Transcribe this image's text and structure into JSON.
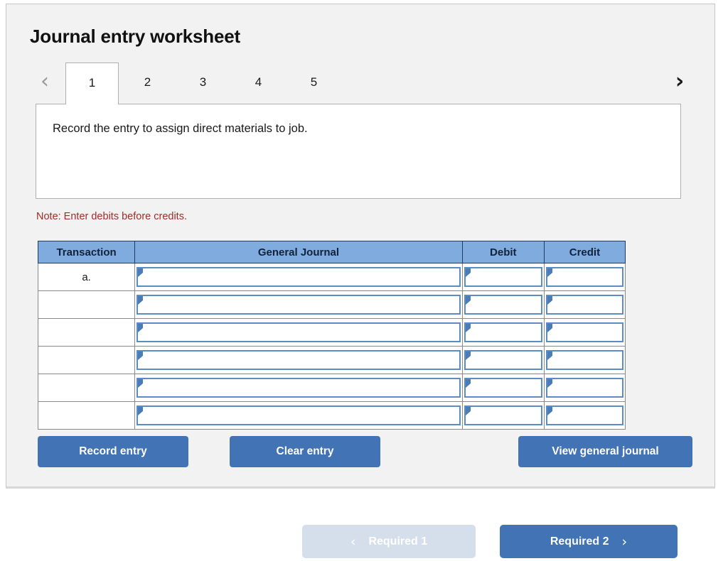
{
  "worksheet": {
    "title": "Journal entry worksheet",
    "tabs": {
      "prev_arrow": "‹",
      "next_arrow": "›",
      "items": [
        {
          "label": "1",
          "active": true
        },
        {
          "label": "2",
          "active": false
        },
        {
          "label": "3",
          "active": false
        },
        {
          "label": "4",
          "active": false
        },
        {
          "label": "5",
          "active": false
        }
      ]
    },
    "instruction": "Record the entry to assign direct materials to job.",
    "note": "Note: Enter debits before credits.",
    "table": {
      "headers": {
        "transaction": "Transaction",
        "general_journal": "General Journal",
        "debit": "Debit",
        "credit": "Credit"
      },
      "rows": [
        {
          "transaction": "a.",
          "general_journal": "",
          "debit": "",
          "credit": ""
        },
        {
          "transaction": "",
          "general_journal": "",
          "debit": "",
          "credit": ""
        },
        {
          "transaction": "",
          "general_journal": "",
          "debit": "",
          "credit": ""
        },
        {
          "transaction": "",
          "general_journal": "",
          "debit": "",
          "credit": ""
        },
        {
          "transaction": "",
          "general_journal": "",
          "debit": "",
          "credit": ""
        },
        {
          "transaction": "",
          "general_journal": "",
          "debit": "",
          "credit": ""
        }
      ]
    },
    "actions": {
      "record_entry": "Record entry",
      "clear_entry": "Clear entry",
      "view_general_journal": "View general journal"
    }
  },
  "footer": {
    "prev": {
      "label": "Required 1",
      "chevron": "‹",
      "disabled": true
    },
    "next": {
      "label": "Required 2",
      "chevron": "›",
      "disabled": false
    }
  },
  "colors": {
    "header_blue": "#7fabde",
    "button_blue": "#4273b5",
    "disabled_blue": "#d5dfec",
    "note_red": "#a32b28",
    "card_bg": "#f2f2f2",
    "input_border_blue": "#5b8cc4"
  }
}
